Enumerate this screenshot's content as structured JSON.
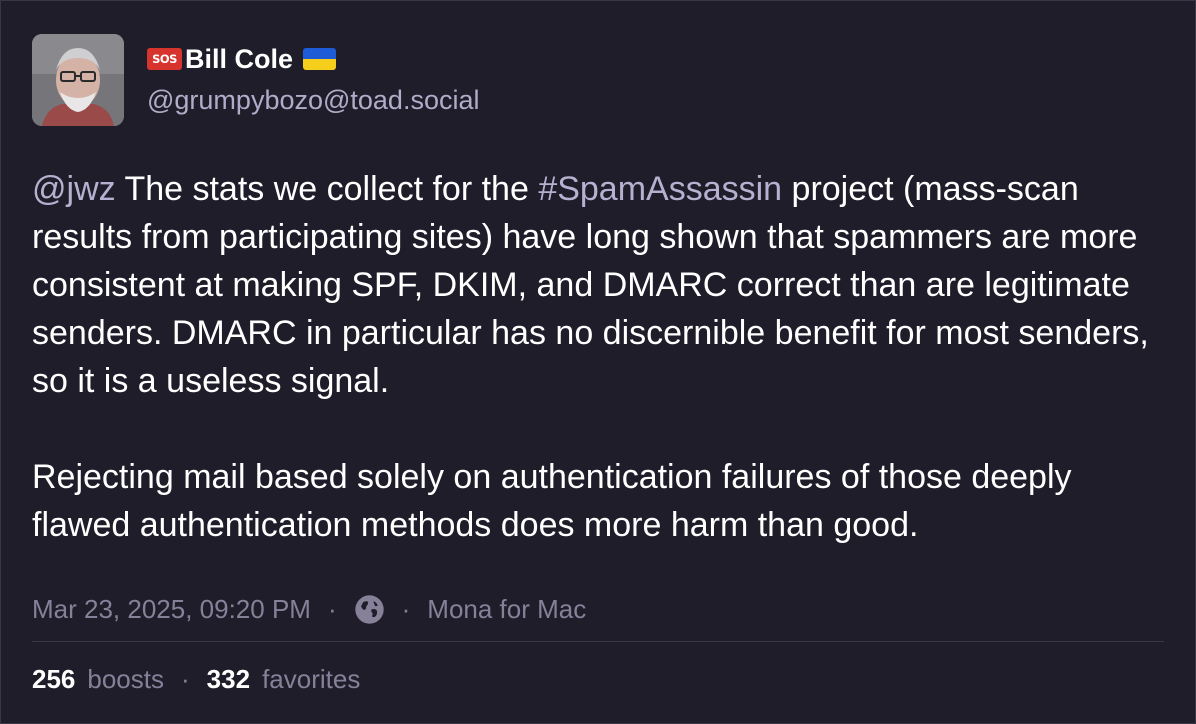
{
  "author": {
    "badge": "SOS",
    "display_name": "Bill Cole",
    "handle": "@grumpybozo@toad.social"
  },
  "post": {
    "paragraph1": {
      "mention": "@jwz",
      "text_before_hashtag": " The stats we collect for the ",
      "hashtag": "#SpamAssassin",
      "text_after_hashtag": " project (mass-scan results from participating sites) have long shown that spammers are more consistent at making SPF, DKIM, and DMARC correct than are legitimate senders. DMARC in particular has no discernible benefit for most senders, so it is a useless signal."
    },
    "paragraph2": "Rejecting mail based solely on authentication failures of those deeply flawed authentication methods does more harm than good."
  },
  "meta": {
    "timestamp": "Mar 23, 2025, 09:20 PM",
    "separator": "·",
    "visibility_icon": "globe-icon",
    "client": "Mona for Mac"
  },
  "stats": {
    "boosts_count": "256",
    "boosts_label": "boosts",
    "separator": "·",
    "favorites_count": "332",
    "favorites_label": "favorites"
  },
  "colors": {
    "background": "#1f1d29",
    "link": "#b6b1d0",
    "muted": "#868199",
    "sos_badge": "#d6342c",
    "flag_blue": "#1e5bd6",
    "flag_yellow": "#f5cf1c"
  }
}
